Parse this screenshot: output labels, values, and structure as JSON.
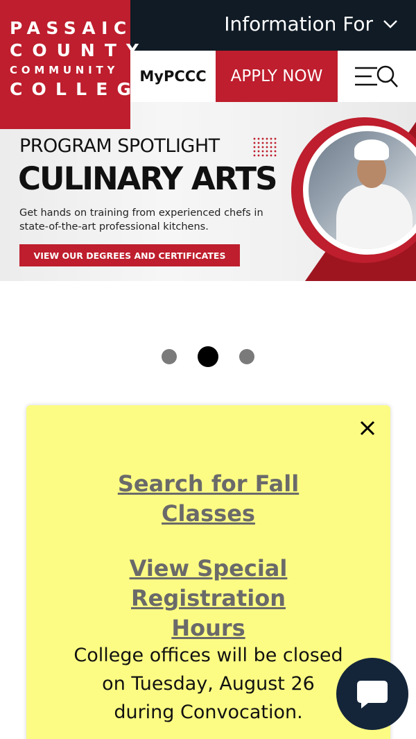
{
  "header": {
    "logo": {
      "line1": "PASSAIC",
      "line2": "COUNTY",
      "line3": "COMMUNITY",
      "line4": "COLLEGE"
    },
    "info_for_label": "Information For",
    "mypccc_label": "MyPCCC",
    "apply_label": "APPLY NOW",
    "icons": [
      "chevron-down-icon",
      "menu-icon",
      "search-icon"
    ]
  },
  "banner": {
    "eyebrow": "PROGRAM SPOTLIGHT",
    "title": "CULINARY ARTS",
    "description": "Get hands on training from experienced chefs in state-of-the-art professional kitchens.",
    "cta_label": "VIEW OUR DEGREES AND CERTIFICATES"
  },
  "carousel": {
    "slide_count": 3,
    "active_index": 1
  },
  "alert": {
    "link1": "Search for Fall Classes",
    "link2": "View Special Registration Hours",
    "message": "College offices will be closed on Tuesday, August 26 during Convocation."
  },
  "colors": {
    "brand_red": "#be1e2d",
    "navy": "#101b25",
    "alert_yellow": "#fcfc84",
    "chat_navy": "#14253a"
  },
  "chat": {
    "icon": "chat-bubble-icon"
  }
}
